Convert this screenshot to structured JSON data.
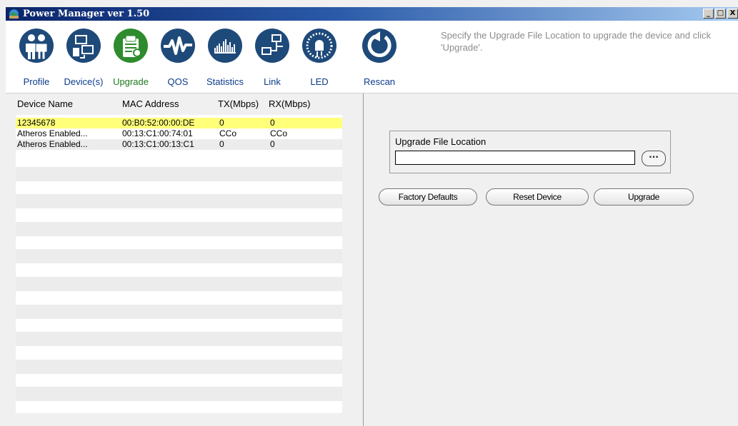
{
  "window": {
    "title": "Power Manager ver 1.50",
    "min": "_",
    "max": "□",
    "close": "X"
  },
  "toolbar": {
    "items": [
      {
        "label": "Profile",
        "icon": "people-icon"
      },
      {
        "label": "Device(s)",
        "icon": "devices-icon"
      },
      {
        "label": "Upgrade",
        "icon": "upgrade-icon"
      },
      {
        "label": "QOS",
        "icon": "waveform-icon"
      },
      {
        "label": "Statistics",
        "icon": "bar-graph-icon"
      },
      {
        "label": "Link",
        "icon": "network-icon"
      },
      {
        "label": "LED",
        "icon": "led-icon"
      },
      {
        "label": "Rescan",
        "icon": "refresh-icon"
      }
    ],
    "active": "Upgrade",
    "instruction": "Specify the Upgrade File Location to upgrade the device and click 'Upgrade'."
  },
  "device_list": {
    "columns": [
      "Device Name",
      "MAC Address",
      "TX(Mbps)",
      "RX(Mbps)"
    ],
    "rows": [
      {
        "name": "12345678",
        "mac": "00:B0:52:00:00:DE",
        "tx": "0",
        "rx": "0"
      },
      {
        "name": "Atheros Enabled...",
        "mac": "00:13:C1:00:74:01",
        "tx": "CCo",
        "rx": "CCo"
      },
      {
        "name": "Atheros Enabled...",
        "mac": "00:13:C1:00:13:C1",
        "tx": "0",
        "rx": "0"
      }
    ],
    "selected_row": 0
  },
  "upgrade": {
    "file_location_label": "Upgrade File Location",
    "file_location_value": "",
    "browse_label": "···",
    "factory_defaults": "Factory Defaults",
    "reset_device": "Reset Device",
    "upgrade": "Upgrade"
  },
  "colors": {
    "title_gradient_start": "#0a246a",
    "title_gradient_end": "#a6caf0",
    "icon_blue": "#1e4a7a",
    "icon_green": "#2e8b2e",
    "selected_row": "#ffff7a",
    "label_blue": "#0b3c8c",
    "label_green": "#1e7a1e"
  }
}
